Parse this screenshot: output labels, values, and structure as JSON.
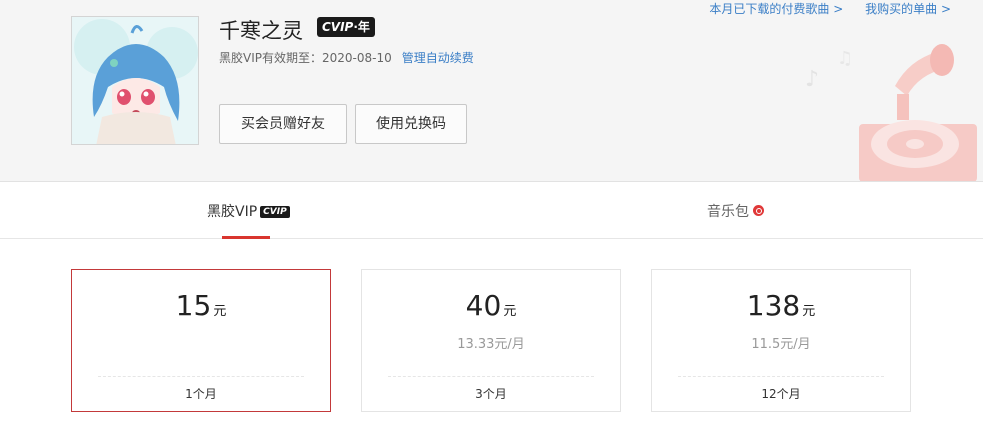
{
  "user": {
    "name": "千寒之灵",
    "vip_badge": {
      "main": "CVIP",
      "sep": "·",
      "suffix": "年"
    },
    "expire_label": "黑胶VIP有效期至：",
    "expire_date": "2020-08-10",
    "manage_link": "管理自动续费"
  },
  "actions": {
    "gift_button": "买会员赠好友",
    "redeem_button": "使用兑换码"
  },
  "top_links": {
    "downloaded": "本月已下载的付费歌曲 >",
    "purchased": "我购买的单曲 >"
  },
  "tabs": {
    "vip_label": "黑胶VIP",
    "vip_badge": "CVIP",
    "music_label": "音乐包"
  },
  "plans": [
    {
      "price": "15",
      "unit": "元",
      "per_month": "",
      "period": "1个月"
    },
    {
      "price": "40",
      "unit": "元",
      "per_month": "13.33元/月",
      "period": "3个月"
    },
    {
      "price": "138",
      "unit": "元",
      "per_month": "11.5元/月",
      "period": "12个月"
    }
  ],
  "colors": {
    "accent": "#d9352f",
    "link": "#3a7ec6",
    "selected_border": "#c3393a"
  }
}
